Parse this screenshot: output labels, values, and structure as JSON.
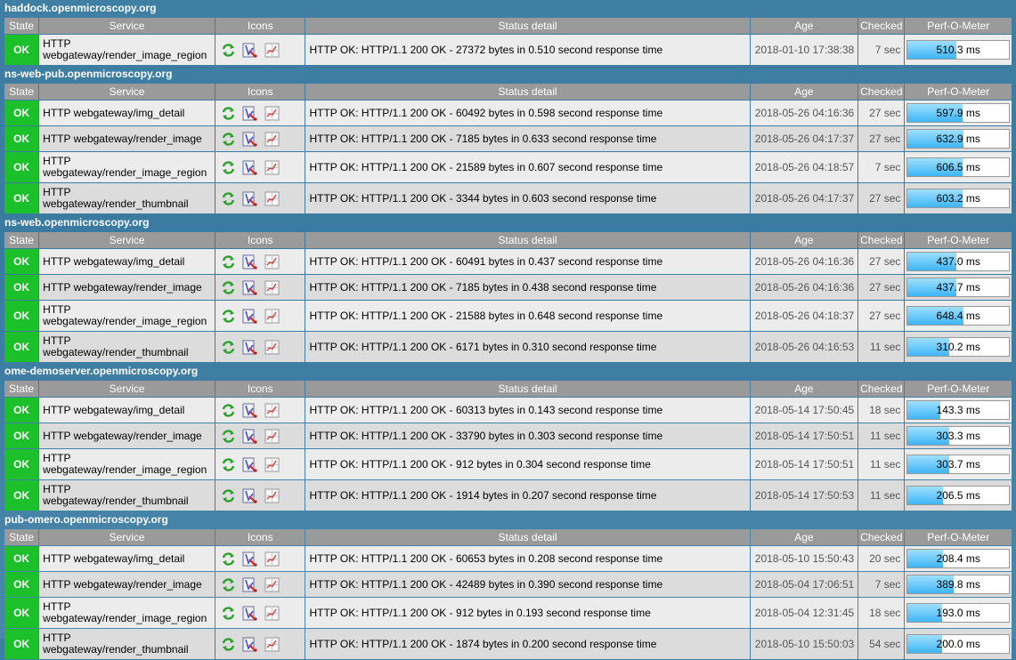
{
  "headers": {
    "state": "State",
    "service": "Service",
    "icons": "Icons",
    "status": "Status detail",
    "age": "Age",
    "checked": "Checked",
    "perf": "Perf-O-Meter"
  },
  "colors": {
    "ok": "#1cc02a",
    "header_bg": "#9a9a9a",
    "page_bg": "#3f7fa3",
    "perf_fill": "#3fb5f5"
  },
  "icons": [
    "reschedule-icon",
    "edit-icon",
    "graph-icon"
  ],
  "hosts": [
    {
      "name": "haddock.openmicroscopy.org",
      "rows": [
        {
          "state": "OK",
          "service": "HTTP webgateway/render_image_region",
          "status": "HTTP OK: HTTP/1.1 200 OK - 27372 bytes in 0.510 second response time",
          "age": "2018-01-10 17:38:38",
          "checked": "7 sec",
          "perf": "510.3 ms",
          "perf_fill": 0.48
        }
      ]
    },
    {
      "name": "ns-web-pub.openmicroscopy.org",
      "rows": [
        {
          "state": "OK",
          "service": "HTTP webgateway/img_detail",
          "status": "HTTP OK: HTTP/1.1 200 OK - 60492 bytes in 0.598 second response time",
          "age": "2018-05-26 04:16:36",
          "checked": "27 sec",
          "perf": "597.9 ms",
          "perf_fill": 0.54
        },
        {
          "state": "OK",
          "service": "HTTP webgateway/render_image",
          "status": "HTTP OK: HTTP/1.1 200 OK - 7185 bytes in 0.633 second response time",
          "age": "2018-05-26 04:17:37",
          "checked": "27 sec",
          "perf": "632.9 ms",
          "perf_fill": 0.55
        },
        {
          "state": "OK",
          "service": "HTTP webgateway/render_image_region",
          "status": "HTTP OK: HTTP/1.1 200 OK - 21589 bytes in 0.607 second response time",
          "age": "2018-05-26 04:18:57",
          "checked": "7 sec",
          "perf": "606.5 ms",
          "perf_fill": 0.54
        },
        {
          "state": "OK",
          "service": "HTTP webgateway/render_thumbnail",
          "status": "HTTP OK: HTTP/1.1 200 OK - 3344 bytes in 0.603 second response time",
          "age": "2018-05-26 04:17:37",
          "checked": "27 sec",
          "perf": "603.2 ms",
          "perf_fill": 0.54
        }
      ]
    },
    {
      "name": "ns-web.openmicroscopy.org",
      "rows": [
        {
          "state": "OK",
          "service": "HTTP webgateway/img_detail",
          "status": "HTTP OK: HTTP/1.1 200 OK - 60491 bytes in 0.437 second response time",
          "age": "2018-05-26 04:16:36",
          "checked": "27 sec",
          "perf": "437.0 ms",
          "perf_fill": 0.48
        },
        {
          "state": "OK",
          "service": "HTTP webgateway/render_image",
          "status": "HTTP OK: HTTP/1.1 200 OK - 7185 bytes in 0.438 second response time",
          "age": "2018-05-26 04:16:36",
          "checked": "27 sec",
          "perf": "437.7 ms",
          "perf_fill": 0.48
        },
        {
          "state": "OK",
          "service": "HTTP webgateway/render_image_region",
          "status": "HTTP OK: HTTP/1.1 200 OK - 21588 bytes in 0.648 second response time",
          "age": "2018-05-26 04:18:37",
          "checked": "27 sec",
          "perf": "648.4 ms",
          "perf_fill": 0.55
        },
        {
          "state": "OK",
          "service": "HTTP webgateway/render_thumbnail",
          "status": "HTTP OK: HTTP/1.1 200 OK - 6171 bytes in 0.310 second response time",
          "age": "2018-05-26 04:16:53",
          "checked": "11 sec",
          "perf": "310.2 ms",
          "perf_fill": 0.41
        }
      ]
    },
    {
      "name": "ome-demoserver.openmicroscopy.org",
      "rows": [
        {
          "state": "OK",
          "service": "HTTP webgateway/img_detail",
          "status": "HTTP OK: HTTP/1.1 200 OK - 60313 bytes in 0.143 second response time",
          "age": "2018-05-14 17:50:45",
          "checked": "18 sec",
          "perf": "143.3 ms",
          "perf_fill": 0.32
        },
        {
          "state": "OK",
          "service": "HTTP webgateway/render_image",
          "status": "HTTP OK: HTTP/1.1 200 OK - 33790 bytes in 0.303 second response time",
          "age": "2018-05-14 17:50:51",
          "checked": "11 sec",
          "perf": "303.3 ms",
          "perf_fill": 0.41
        },
        {
          "state": "OK",
          "service": "HTTP webgateway/render_image_region",
          "status": "HTTP OK: HTTP/1.1 200 OK - 912 bytes in 0.304 second response time",
          "age": "2018-05-14 17:50:51",
          "checked": "11 sec",
          "perf": "303.7 ms",
          "perf_fill": 0.41
        },
        {
          "state": "OK",
          "service": "HTTP webgateway/render_thumbnail",
          "status": "HTTP OK: HTTP/1.1 200 OK - 1914 bytes in 0.207 second response time",
          "age": "2018-05-14 17:50:53",
          "checked": "11 sec",
          "perf": "206.5 ms",
          "perf_fill": 0.35
        }
      ]
    },
    {
      "name": "pub-omero.openmicroscopy.org",
      "rows": [
        {
          "state": "OK",
          "service": "HTTP webgateway/img_detail",
          "status": "HTTP OK: HTTP/1.1 200 OK - 60653 bytes in 0.208 second response time",
          "age": "2018-05-10 15:50:43",
          "checked": "20 sec",
          "perf": "208.4 ms",
          "perf_fill": 0.35
        },
        {
          "state": "OK",
          "service": "HTTP webgateway/render_image",
          "status": "HTTP OK: HTTP/1.1 200 OK - 42489 bytes in 0.390 second response time",
          "age": "2018-05-04 17:06:51",
          "checked": "7 sec",
          "perf": "389.8 ms",
          "perf_fill": 0.45
        },
        {
          "state": "OK",
          "service": "HTTP webgateway/render_image_region",
          "status": "HTTP OK: HTTP/1.1 200 OK - 912 bytes in 0.193 second response time",
          "age": "2018-05-04 12:31:45",
          "checked": "18 sec",
          "perf": "193.0 ms",
          "perf_fill": 0.34
        },
        {
          "state": "OK",
          "service": "HTTP webgateway/render_thumbnail",
          "status": "HTTP OK: HTTP/1.1 200 OK - 1874 bytes in 0.200 second response time",
          "age": "2018-05-10 15:50:03",
          "checked": "54 sec",
          "perf": "200.0 ms",
          "perf_fill": 0.34
        }
      ]
    }
  ]
}
